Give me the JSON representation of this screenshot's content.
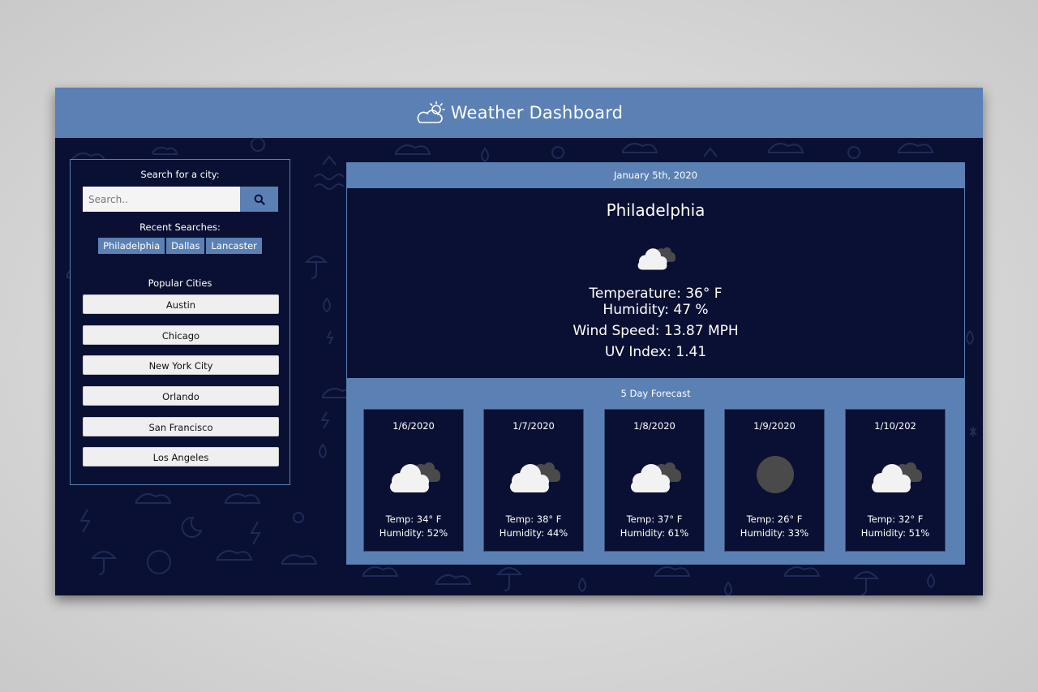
{
  "colors": {
    "header_bg": "#5b80b4",
    "page_bg": "#0a1033",
    "accent": "#5b80b4",
    "button_bg": "#efefef"
  },
  "header": {
    "title": "Weather Dashboard",
    "logo_icon": "partly-cloudy-sun-icon"
  },
  "sidebar": {
    "search_label": "Search for a city:",
    "search_placeholder": "Search..",
    "search_button_icon": "search-icon",
    "recent_label": "Recent Searches:",
    "recent": [
      "Philadelphia",
      "Dallas",
      "Lancaster"
    ],
    "popular_label": "Popular Cities",
    "popular": [
      "Austin",
      "Chicago",
      "New York City",
      "Orlando",
      "San Francisco",
      "Los Angeles"
    ]
  },
  "current": {
    "date": "January 5th, 2020",
    "city": "Philadelphia",
    "icon": "cloudy-icon",
    "temperature": "Temperature: 36° F",
    "humidity": "Humidity: 47 %",
    "wind_speed": "Wind Speed: 13.87 MPH",
    "uv_index": "UV Index: 1.41"
  },
  "forecast": {
    "title": "5 Day Forecast",
    "days": [
      {
        "date": "1/6/2020",
        "icon": "cloudy-icon",
        "temp": "Temp: 34° F",
        "humidity": "Humidity: 52%"
      },
      {
        "date": "1/7/2020",
        "icon": "cloudy-icon",
        "temp": "Temp: 38° F",
        "humidity": "Humidity: 44%"
      },
      {
        "date": "1/8/2020",
        "icon": "cloudy-icon",
        "temp": "Temp: 37° F",
        "humidity": "Humidity: 61%"
      },
      {
        "date": "1/9/2020",
        "icon": "full-moon-icon",
        "temp": "Temp: 26° F",
        "humidity": "Humidity: 33%"
      },
      {
        "date": "1/10/202",
        "icon": "cloudy-icon",
        "temp": "Temp: 32° F",
        "humidity": "Humidity: 51%"
      }
    ]
  }
}
